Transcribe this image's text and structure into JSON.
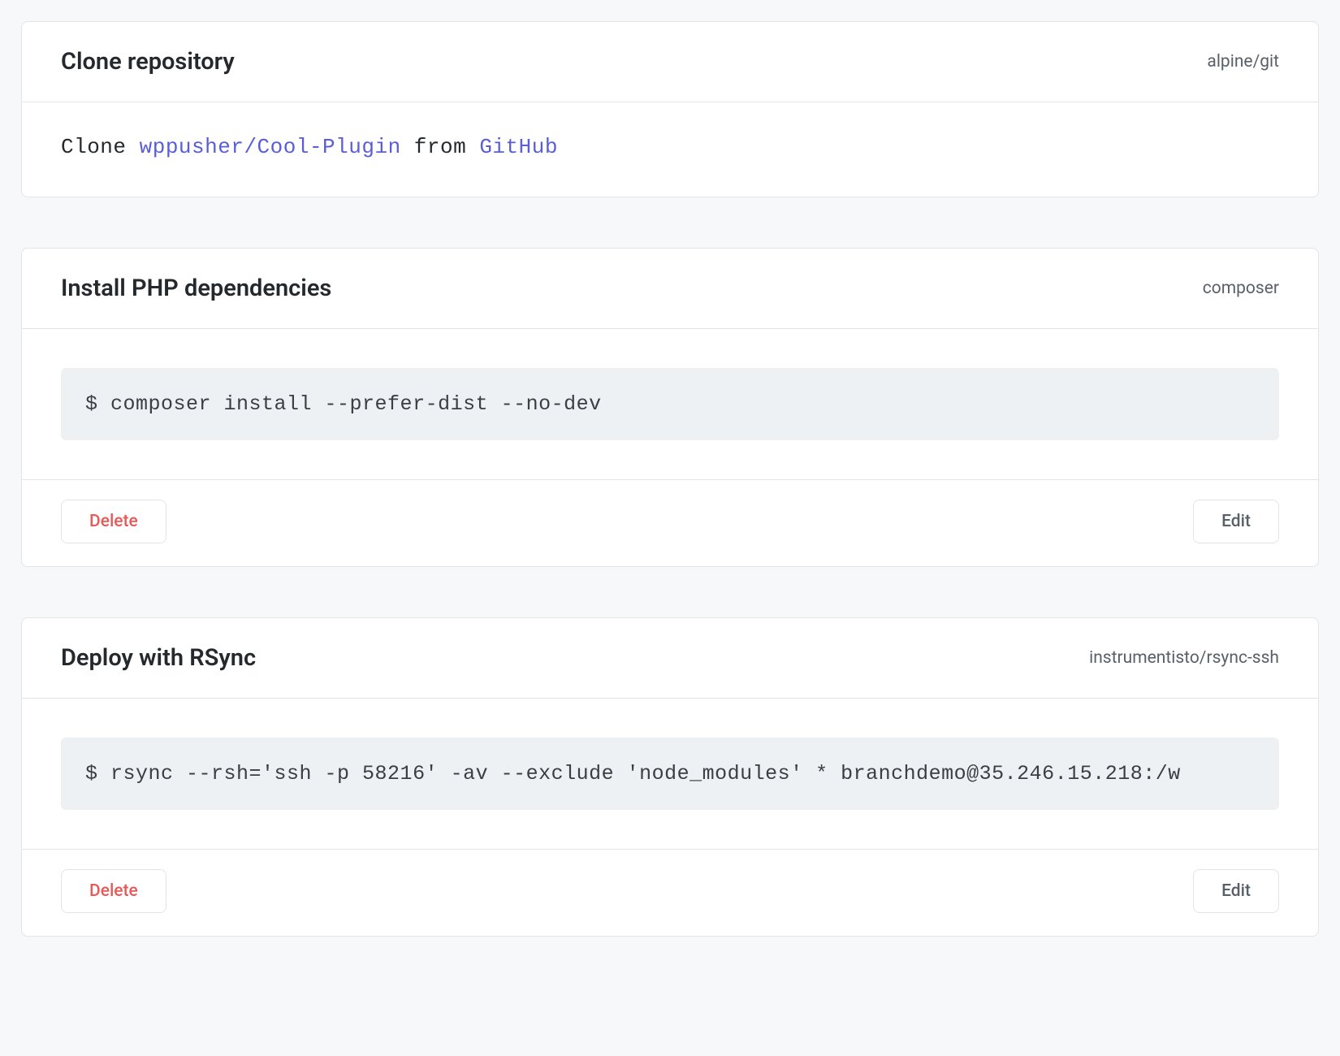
{
  "cards": [
    {
      "title": "Clone repository",
      "tag": "alpine/git",
      "clone_prefix": "Clone ",
      "clone_repo": "wppusher/Cool-Plugin",
      "clone_middle": " from ",
      "clone_source": "GitHub"
    },
    {
      "title": "Install PHP dependencies",
      "tag": "composer",
      "command": "$ composer install --prefer-dist --no-dev",
      "delete_label": "Delete",
      "edit_label": "Edit"
    },
    {
      "title": "Deploy with RSync",
      "tag": "instrumentisto/rsync-ssh",
      "command": "$ rsync --rsh='ssh -p 58216' -av --exclude 'node_modules' * branchdemo@35.246.15.218:/w",
      "delete_label": "Delete",
      "edit_label": "Edit"
    }
  ]
}
